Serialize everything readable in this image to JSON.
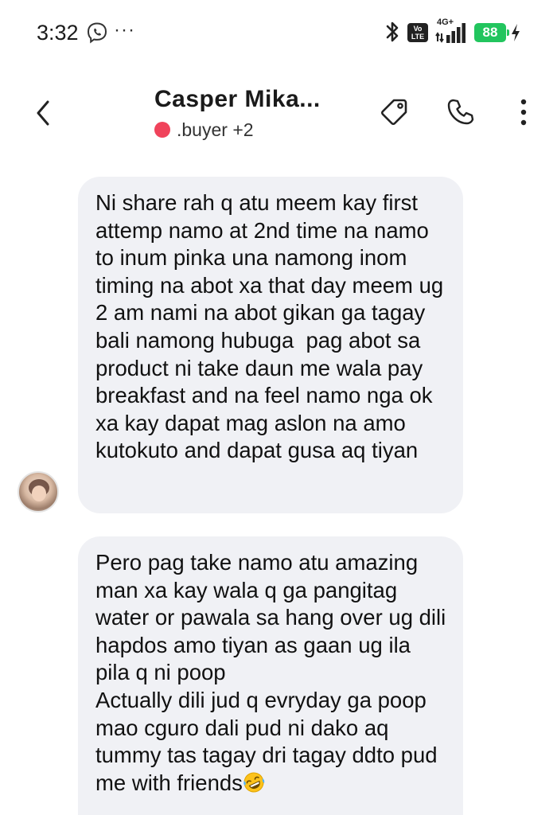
{
  "status_bar": {
    "time": "3:32",
    "more": "···",
    "network": "4G+",
    "volte": "Vo LTE",
    "battery": "88"
  },
  "header": {
    "title": "Casper Mika...",
    "subtitle": ".buyer +2",
    "status_dot_color": "#f0435b"
  },
  "messages": [
    {
      "text": "Ni share rah q atu meem kay first attemp namo at 2nd time na namo to inum pinka una namong inom timing na abot xa that day meem ug 2 am nami na abot gikan ga tagay bali namong hubuga  pag abot sa product ni take daun me wala pay breakfast and na feel namo nga ok xa kay dapat mag aslon na amo kutokuto and dapat gusa aq tiyan"
    },
    {
      "text": "Pero pag take namo atu amazing man xa kay wala q ga pangitag water or pawala sa hang over ug dili hapdos amo tiyan as gaan ug ila pila q ni poop\nActually dili jud q evryday ga poop mao cguro dali pud ni dako aq tummy tas tagay dri tagay ddto pud me with friends",
      "emoji": "rolling-on-floor-laughing"
    }
  ],
  "icons": {
    "back": "chevron-left-icon",
    "tag": "tag-icon",
    "call": "phone-icon",
    "menu": "more-vertical-icon"
  }
}
